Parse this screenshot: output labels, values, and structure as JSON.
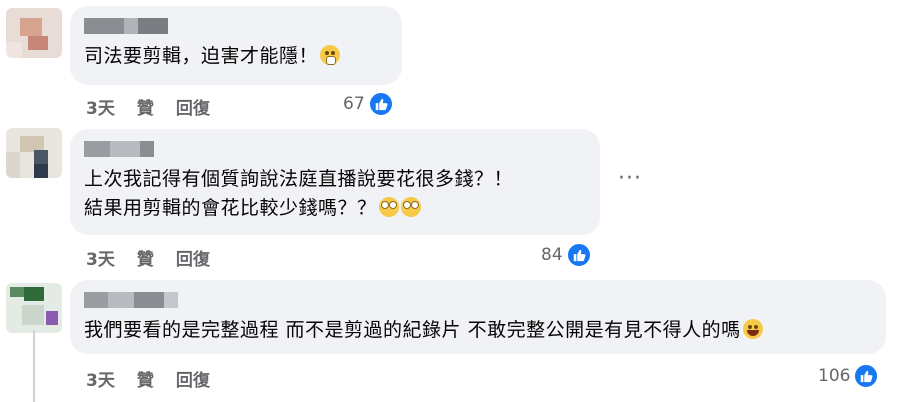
{
  "comments": [
    {
      "text": "司法要剪輯，迫害才能隱！",
      "emoji": "scream",
      "time": "3天",
      "like_label": "贊",
      "reply_label": "回復",
      "like_count": "67"
    },
    {
      "lines": [
        "上次我記得有個質詢說法庭直播說要花很多錢？！",
        "結果用剪輯的會花比較少錢嗎？？"
      ],
      "emojis": [
        "roll-eyes",
        "roll-eyes"
      ],
      "time": "3天",
      "like_label": "贊",
      "reply_label": "回復",
      "like_count": "84",
      "more_label": "···"
    },
    {
      "text": "我們要看的是完整過程 而不是剪過的紀錄片 不敢完整公開是有見不得人的嗎",
      "emoji": "rolling-laughing",
      "time": "3天",
      "like_label": "贊",
      "reply_label": "回復",
      "like_count": "106"
    }
  ],
  "colors": {
    "bubble": "#f0f2f5",
    "meta_text": "#65676b",
    "like_blue": "#1877f2"
  }
}
